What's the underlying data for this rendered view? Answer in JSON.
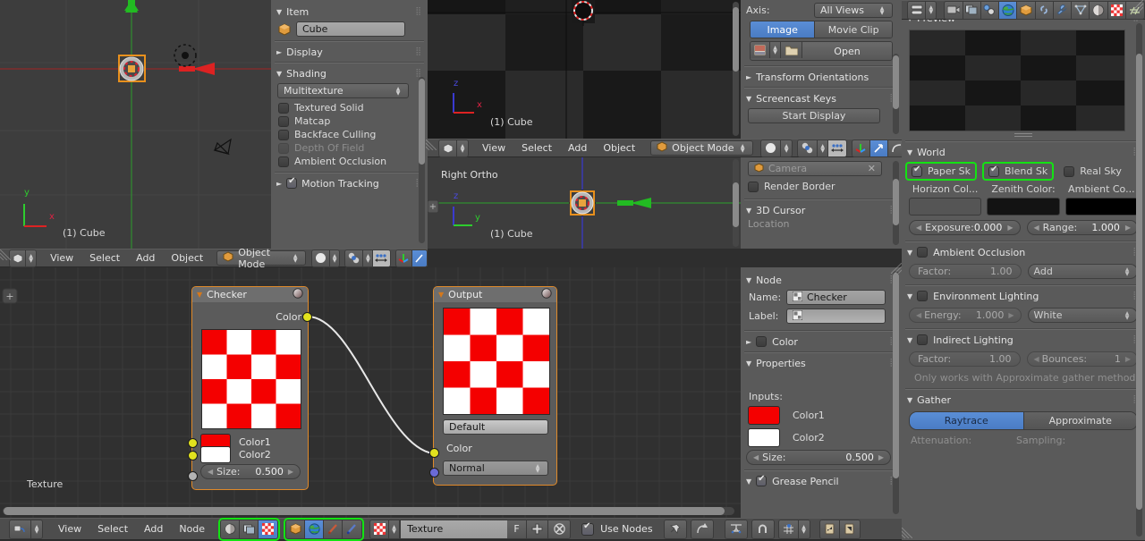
{
  "viewport_top_left": {
    "axis_x_label": "x",
    "axis_y_label": "y",
    "object_label": "(1) Cube"
  },
  "viewport_top_mid": {
    "axis_z_label": "z",
    "axis_x_label": "x",
    "object_label": "(1) Cube"
  },
  "viewport_bottom_mid": {
    "view_name": "Right Ortho",
    "axis_z_label": "z",
    "axis_y_label": "y",
    "object_label": "(1) Cube"
  },
  "headers": {
    "view": "View",
    "select": "Select",
    "add": "Add",
    "object": "Object",
    "node": "Node",
    "object_mode": "Object Mode"
  },
  "nprops": {
    "item": {
      "title": "Item",
      "object_name": "Cube"
    },
    "display": {
      "title": "Display"
    },
    "shading": {
      "title": "Shading",
      "method": "Multitexture",
      "options": [
        {
          "label": "Textured Solid",
          "checked": false,
          "disabled": false
        },
        {
          "label": "Matcap",
          "checked": false,
          "disabled": false
        },
        {
          "label": "Backface Culling",
          "checked": false,
          "disabled": false
        },
        {
          "label": "Depth Of Field",
          "checked": false,
          "disabled": true
        },
        {
          "label": "Ambient Occlusion",
          "checked": false,
          "disabled": false
        }
      ]
    },
    "motion_tracking": {
      "title": "Motion Tracking",
      "checked": true
    }
  },
  "bg_images": {
    "axis_label": "Axis:",
    "axis_value": "All Views",
    "source_image": "Image",
    "source_movie": "Movie Clip",
    "open": "Open"
  },
  "mid_props": {
    "transform_orientations": "Transform Orientations",
    "screencast_keys": "Screencast Keys",
    "start_display": "Start Display",
    "camera_field": "Camera",
    "render_border": "Render Border",
    "cursor_3d": "3D Cursor",
    "location_hint": "Location"
  },
  "node_props": {
    "node_title": "Node",
    "name_label": "Name:",
    "name_value": "Checker",
    "label_label": "Label:",
    "label_value": "",
    "color_title": "Color",
    "properties_title": "Properties",
    "inputs_label": "Inputs:",
    "color1": "Color1",
    "color1_hex": "#ff0000",
    "color2": "Color2",
    "color2_hex": "#ffffff",
    "size_label": "Size:",
    "size_value": "0.500",
    "grease_pencil": "Grease Pencil"
  },
  "node_editor": {
    "editor_label": "Texture",
    "checker_node": {
      "title": "Checker",
      "output_socket": "Color",
      "color1": "Color1",
      "color1_hex": "#ff0000",
      "color2": "Color2",
      "color2_hex": "#ffffff",
      "size_label": "Size:",
      "size_value": "0.500"
    },
    "output_node": {
      "title": "Output",
      "preset": "Default",
      "color_socket": "Color",
      "normal_socket": "Normal"
    }
  },
  "node_footer": {
    "texture_name": "Texture",
    "fake_user": "F",
    "use_nodes": "Use Nodes",
    "use_nodes_checked": true
  },
  "world_props": {
    "preview_title": "Preview",
    "world_title": "World",
    "paper_sky": "Paper Sk",
    "paper_sky_checked": true,
    "blend_sky": "Blend Sk",
    "blend_sky_checked": true,
    "real_sky": "Real Sky",
    "real_sky_checked": false,
    "horizon_color_label": "Horizon Col...",
    "horizon_color_hex": "#555555",
    "zenith_color_label": "Zenith Color:",
    "zenith_color_hex": "#131313",
    "ambient_color_label": "Ambient Co...",
    "ambient_color_hex": "#000000",
    "exposure_label": "Exposure:",
    "exposure_value": "0.000",
    "range_label": "Range:",
    "range_value": "1.000",
    "ambient_occlusion": "Ambient Occlusion",
    "ao_factor_label": "Factor:",
    "ao_factor_value": "1.00",
    "ao_blend": "Add",
    "environment_lighting": "Environment Lighting",
    "env_energy_label": "Energy:",
    "env_energy_value": "1.000",
    "env_color": "White",
    "indirect_lighting": "Indirect Lighting",
    "ind_factor_label": "Factor:",
    "ind_factor_value": "1.00",
    "ind_bounces_label": "Bounces:",
    "ind_bounces_value": "1",
    "indirect_note": "Only works with Approximate gather method",
    "gather_title": "Gather",
    "gather_raytrace": "Raytrace",
    "gather_approximate": "Approximate",
    "attenuation_label": "Attenuation:",
    "sampling_label": "Sampling:"
  },
  "icons": {
    "editor_type": "editor-type-icon",
    "render": "camera-render-icon",
    "scene": "scene-icon",
    "world": "world-globe-icon",
    "object": "object-cube-icon",
    "constraints": "chain-link-icon",
    "modifiers": "wrench-icon",
    "data": "mesh-data-icon",
    "material": "material-sphere-icon",
    "texture": "texture-checker-icon",
    "particles": "particles-icon"
  },
  "colors": {
    "accent_blue": "#5a8ed6",
    "highlight_green": "#13e313",
    "node_border": "#e08a2a",
    "socket_yellow": "#e2e21e",
    "socket_blue": "#6a6ad6"
  }
}
